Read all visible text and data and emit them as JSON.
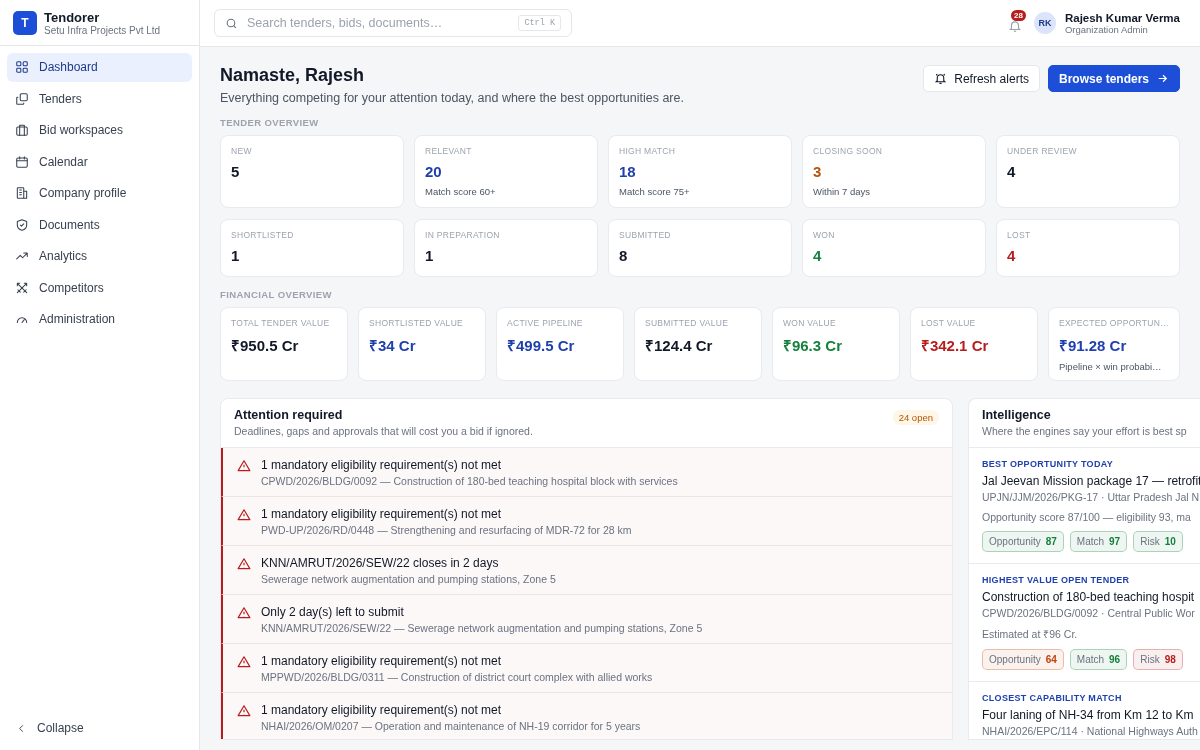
{
  "brand": {
    "logo": "T",
    "name": "Tendorer",
    "org": "Setu Infra Projects Pvt Ltd"
  },
  "sidebar": {
    "items": [
      {
        "label": "Dashboard",
        "selected": true
      },
      {
        "label": "Tenders",
        "selected": false
      },
      {
        "label": "Bid workspaces",
        "selected": false
      },
      {
        "label": "Calendar",
        "selected": false
      },
      {
        "label": "Company profile",
        "selected": false
      },
      {
        "label": "Documents",
        "selected": false
      },
      {
        "label": "Analytics",
        "selected": false
      },
      {
        "label": "Competitors",
        "selected": false
      },
      {
        "label": "Administration",
        "selected": false
      }
    ],
    "collapse": "Collapse"
  },
  "search": {
    "placeholder": "Search tenders, bids, documents…",
    "shortcut": "Ctrl K"
  },
  "notifications": {
    "count": "28"
  },
  "user": {
    "initials": "RK",
    "name": "Rajesh Kumar Verma",
    "role": "Organization Admin"
  },
  "greeting": {
    "title": "Namaste, Rajesh",
    "subtitle": "Everything competing for your attention today, and where the best opportunities are."
  },
  "buttons": {
    "refresh": "Refresh alerts",
    "browse": "Browse tenders"
  },
  "tender_overview": {
    "heading": "TENDER OVERVIEW",
    "cards": [
      {
        "label": "NEW",
        "value": "5",
        "color": "#111827"
      },
      {
        "label": "RELEVANT",
        "value": "20",
        "note": "Match score 60+",
        "color": "#1e3fae"
      },
      {
        "label": "HIGH MATCH",
        "value": "18",
        "note": "Match score 75+",
        "color": "#1e3fae"
      },
      {
        "label": "CLOSING SOON",
        "value": "3",
        "note": "Within 7 days",
        "color": "#b45309"
      },
      {
        "label": "UNDER REVIEW",
        "value": "4",
        "color": "#111827"
      },
      {
        "label": "SHORTLISTED",
        "value": "1",
        "color": "#111827"
      },
      {
        "label": "IN PREPARATION",
        "value": "1",
        "color": "#111827"
      },
      {
        "label": "SUBMITTED",
        "value": "8",
        "color": "#111827"
      },
      {
        "label": "WON",
        "value": "4",
        "color": "#15803d"
      },
      {
        "label": "LOST",
        "value": "4",
        "color": "#b91c1c"
      }
    ]
  },
  "financial_overview": {
    "heading": "FINANCIAL OVERVIEW",
    "cards": [
      {
        "label": "TOTAL TENDER VALUE",
        "value": "₹950.5 Cr",
        "color": "#111827"
      },
      {
        "label": "SHORTLISTED VALUE",
        "value": "₹34 Cr",
        "color": "#1e3fae"
      },
      {
        "label": "ACTIVE PIPELINE",
        "value": "₹499.5 Cr",
        "color": "#1e3fae"
      },
      {
        "label": "SUBMITTED VALUE",
        "value": "₹124.4 Cr",
        "color": "#111827"
      },
      {
        "label": "WON VALUE",
        "value": "₹96.3 Cr",
        "color": "#15803d"
      },
      {
        "label": "LOST VALUE",
        "value": "₹342.1 Cr",
        "color": "#b91c1c"
      },
      {
        "label": "EXPECTED OPPORTUN…",
        "value": "₹91.28 Cr",
        "note": "Pipeline × win probabi…",
        "color": "#1e3fae"
      }
    ]
  },
  "attention": {
    "title": "Attention required",
    "subtitle": "Deadlines, gaps and approvals that will cost you a bid if ignored.",
    "badge": "24 open",
    "items": [
      {
        "title": "1 mandatory eligibility requirement(s) not met",
        "detail": "CPWD/2026/BLDG/0092 — Construction of 180-bed teaching hospital block with services"
      },
      {
        "title": "1 mandatory eligibility requirement(s) not met",
        "detail": "PWD-UP/2026/RD/0448 — Strengthening and resurfacing of MDR-72 for 28 km"
      },
      {
        "title": "KNN/AMRUT/2026/SEW/22 closes in 2 days",
        "detail": "Sewerage network augmentation and pumping stations, Zone 5"
      },
      {
        "title": "Only 2 day(s) left to submit",
        "detail": "KNN/AMRUT/2026/SEW/22 — Sewerage network augmentation and pumping stations, Zone 5"
      },
      {
        "title": "1 mandatory eligibility requirement(s) not met",
        "detail": "MPPWD/2026/BLDG/0311 — Construction of district court complex with allied works"
      },
      {
        "title": "1 mandatory eligibility requirement(s) not met",
        "detail": "NHAI/2026/OM/0207 — Operation and maintenance of NH-19 corridor for 5 years"
      }
    ]
  },
  "intelligence": {
    "title": "Intelligence",
    "subtitle": "Where the engines say your effort is best sp",
    "sections": [
      {
        "heading": "BEST OPPORTUNITY TODAY",
        "title": "Jal Jeevan Mission package 17 — retrofit",
        "meta": "UPJN/JJM/2026/PKG-17 · Uttar Pradesh Jal N",
        "note": "Opportunity score 87/100 — eligibility 93, ma",
        "chips": [
          {
            "label": "Opportunity",
            "value": "87",
            "color": "#15803d"
          },
          {
            "label": "Match",
            "value": "97",
            "color": "#15803d"
          },
          {
            "label": "Risk",
            "value": "10",
            "color": "#15803d"
          }
        ]
      },
      {
        "heading": "HIGHEST VALUE OPEN TENDER",
        "title": "Construction of 180-bed teaching hospit",
        "meta": "CPWD/2026/BLDG/0092 · Central Public Wor",
        "note": "Estimated at ₹96 Cr.",
        "chips": [
          {
            "label": "Opportunity",
            "value": "64",
            "color": "#c2410c"
          },
          {
            "label": "Match",
            "value": "96",
            "color": "#15803d"
          },
          {
            "label": "Risk",
            "value": "98",
            "color": "#b91c1c"
          }
        ]
      },
      {
        "heading": "CLOSEST CAPABILITY MATCH",
        "title": "Four laning of NH-34 from Km 12 to Km",
        "meta": "NHAI/2026/EPC/114 · National Highways Auth"
      }
    ]
  }
}
